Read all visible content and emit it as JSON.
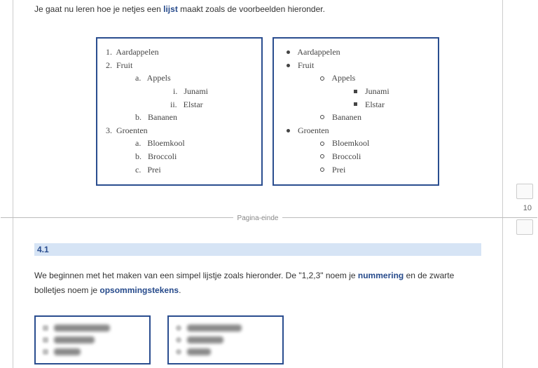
{
  "intro": {
    "pre": "Je gaat nu leren hoe je netjes een ",
    "link": "lijst",
    "post": " maakt zoals de voorbeelden hieronder."
  },
  "example_numbered": {
    "l1": "1.  Aardappelen",
    "l2": "2.  Fruit",
    "l3": "a.   Appels",
    "l4": "i.   Junami",
    "l5": "ii.   Elstar",
    "l6": "b.   Bananen",
    "l7": "3.  Groenten",
    "l8": "a.   Bloemkool",
    "l9": "b.   Broccoli",
    "l10": "c.   Prei"
  },
  "example_bullets": {
    "l1": "Aardappelen",
    "l2": "Fruit",
    "l3": "Appels",
    "l4": "Junami",
    "l5": "Elstar",
    "l6": "Bananen",
    "l7": "Groenten",
    "l8": "Bloemkool",
    "l9": "Broccoli",
    "l10": "Prei"
  },
  "page_break_label": "Pagina-einde",
  "section_heading": "4.1",
  "para2": {
    "t1": "We beginnen met het maken van een simpel lijstje zoals hieronder. De \"1,2,3\" noem je ",
    "link1": "nummering",
    "t2": " en de zwarte bolletjes noem je ",
    "link2": "opsommingstekens",
    "t3": "."
  },
  "gutter": {
    "count": "10"
  }
}
